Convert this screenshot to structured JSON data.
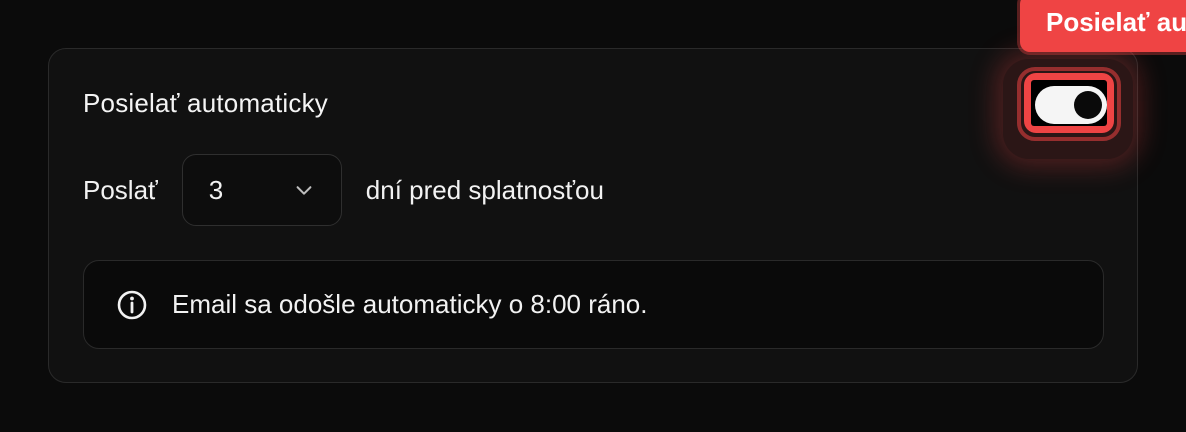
{
  "settings_card": {
    "title": "Posielať automaticky",
    "toggle": {
      "state": "on"
    },
    "send_row": {
      "prefix": "Poslať",
      "days_select": {
        "value": "3"
      },
      "suffix": "dní pred splatnosťou"
    },
    "info": {
      "icon": "info-icon",
      "text": "Email sa odošle automaticky o 8:00 ráno."
    }
  },
  "tooltip": {
    "text": "Posielať au"
  },
  "colors": {
    "background": "#0b0b0b",
    "card": "#111111",
    "accent_red": "#ef4444",
    "text": "#f2f2f2"
  }
}
